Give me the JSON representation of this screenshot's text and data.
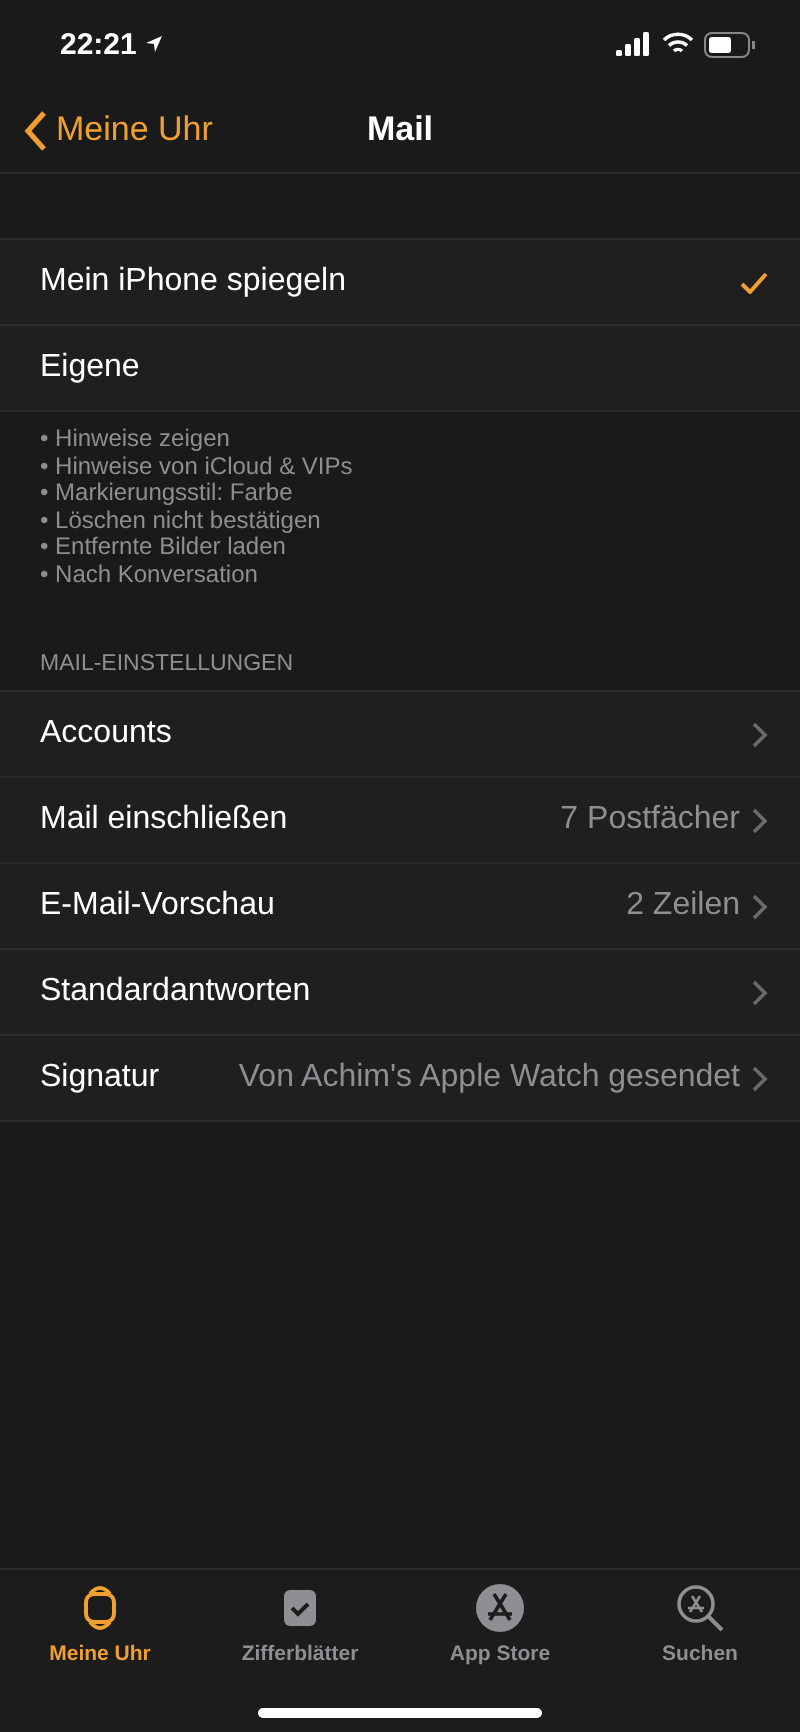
{
  "status_bar": {
    "time": "22:21"
  },
  "nav": {
    "back": "Meine Uhr",
    "title": "Mail"
  },
  "mode_options": [
    {
      "label": "Mein iPhone spiegeln",
      "selected": true
    },
    {
      "label": "Eigene",
      "selected": false
    }
  ],
  "summary": [
    "• Hinweise zeigen",
    "• Hinweise von iCloud & VIPs",
    "• Markierungsstil: Farbe",
    "• Löschen nicht bestätigen",
    "• Entfernte Bilder laden",
    "• Nach Konversation"
  ],
  "section_header": "MAIL-EINSTELLUNGEN",
  "settings": [
    {
      "label": "Accounts"
    },
    {
      "label": "Mail einschließen",
      "value": "7 Postfächer"
    },
    {
      "label": "E-Mail-Vorschau",
      "value": "2 Zeilen"
    },
    {
      "label": "Standardantworten"
    },
    {
      "label": "Signatur",
      "value": "Von Achim's Apple Watch gesendet"
    }
  ],
  "tabs": [
    {
      "label": "Meine Uhr",
      "kind": "watch",
      "selected": true
    },
    {
      "label": "Zifferblätter",
      "kind": "faces",
      "selected": false
    },
    {
      "label": "App Store",
      "kind": "store",
      "selected": false
    },
    {
      "label": "Suchen",
      "kind": "search",
      "selected": false
    }
  ]
}
